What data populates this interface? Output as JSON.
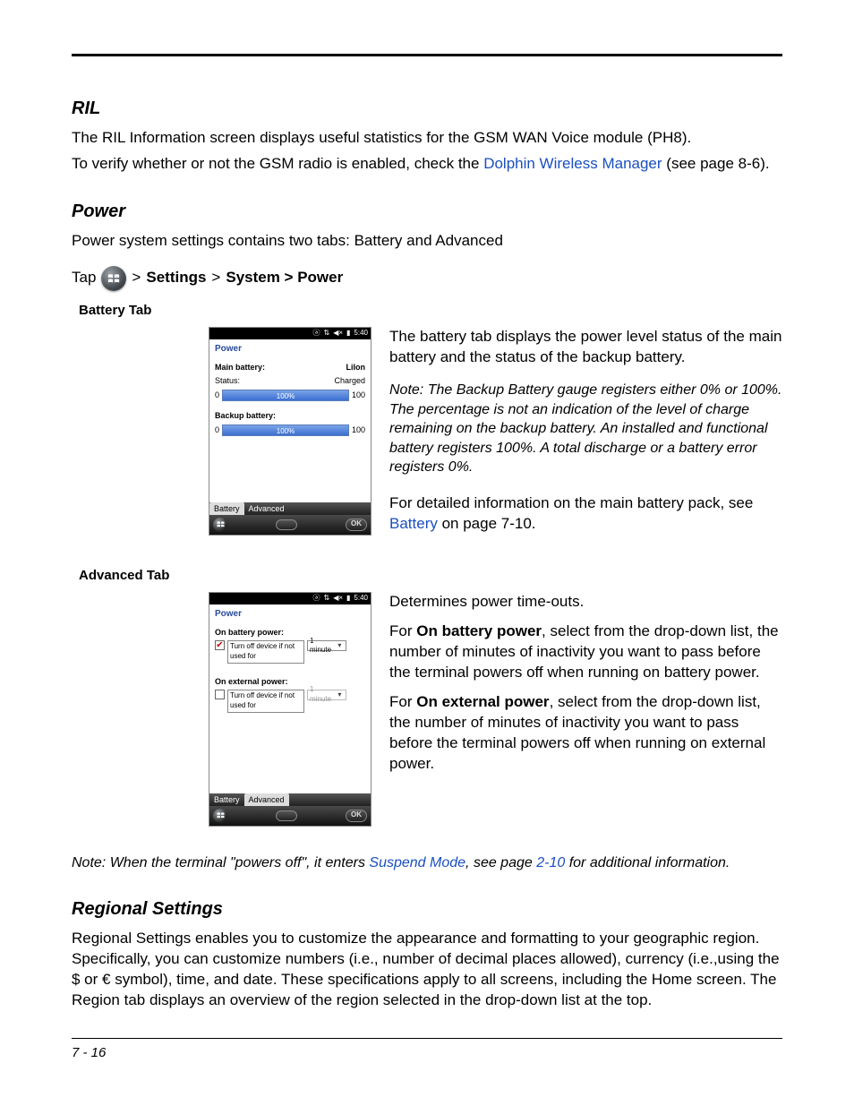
{
  "ril": {
    "heading": "RIL",
    "p1": "The RIL Information screen displays useful statistics for the GSM WAN Voice module (PH8).",
    "p2a": "To verify whether or not the GSM radio is enabled, check the ",
    "p2_link": "Dolphin Wireless Manager",
    "p2b": " (see page 8-6)."
  },
  "power": {
    "heading": "Power",
    "intro": "Power system settings contains two tabs: Battery and Advanced",
    "nav_tap": "Tap",
    "nav_gt1": " > ",
    "nav_settings": "Settings",
    "nav_gt2": " > ",
    "nav_system": "System > Power"
  },
  "battery_tab": {
    "label": "Battery Tab",
    "status_time": "5:40",
    "title": "Power",
    "main_label": "Main battery:",
    "main_type": "LiIon",
    "status_label": "Status:",
    "status_value": "Charged",
    "backup_label": "Backup battery:",
    "pct": "100%",
    "zero": "0",
    "hundred": "100",
    "tab_battery": "Battery",
    "tab_advanced": "Advanced",
    "ok": "OK",
    "desc1": "The battery tab displays the power level status of the main battery and the status of the backup battery.",
    "note_prefix": "Note:",
    "note_body": "The Backup Battery gauge registers either 0% or 100%. The percentage is not an indication of the level of charge remaining on the backup battery. An installed and functional battery registers 100%. A total discharge or a battery error registers 0%.",
    "desc2a": "For detailed information on the main battery pack, see ",
    "desc2_link": "Battery",
    "desc2b": " on page 7-10."
  },
  "advanced_tab": {
    "label": "Advanced Tab",
    "status_time": "5:40",
    "title": "Power",
    "on_batt": "On battery power:",
    "on_ext": "On external power:",
    "chk_text": "Turn off device if not used for",
    "select_val": "1 minute",
    "tab_battery": "Battery",
    "tab_advanced": "Advanced",
    "ok": "OK",
    "desc1": "Determines power time-outs.",
    "desc2a": "For ",
    "desc2b": "On battery power",
    "desc2c": ", select from the drop-down list, the number of minutes of inactivity you want to pass before the terminal powers off when running on battery power.",
    "desc3a": "For ",
    "desc3b": "On external power",
    "desc3c": ", select from the drop-down list, the number of minutes of inactivity you want to pass before the terminal powers off when running on external power."
  },
  "suspend_note": {
    "prefix": "Note:",
    "a": " When the terminal \"powers off\", it enters ",
    "link1": "Suspend Mode",
    "b": ", see page ",
    "link2": "2-10",
    "c": " for additional information."
  },
  "regional": {
    "heading": "Regional Settings",
    "body": "Regional Settings enables you to customize the appearance and formatting to your geographic region. Specifically, you can customize numbers (i.e., number of decimal places allowed), currency (i.e.,using the $ or € symbol), time, and date. These specifications apply to all screens, including the Home screen. The Region tab displays an overview of the region selected in the drop-down list at the top."
  },
  "footer": "7 - 16"
}
